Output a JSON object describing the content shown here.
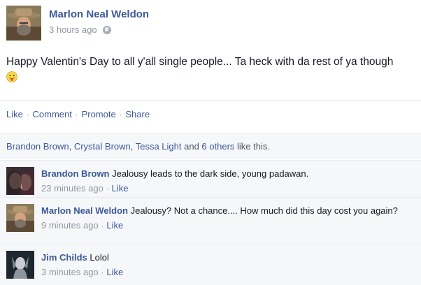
{
  "post": {
    "author": "Marlon Neal Weldon",
    "timestamp": "3 hours ago",
    "privacy_icon": "globe-icon",
    "text": "Happy Valentin's Day to all y'all single people... Ta heck with da rest of ya though",
    "emoji": "tongue-out-face"
  },
  "actions": {
    "like": "Like",
    "comment": "Comment",
    "promote": "Promote",
    "share": "Share",
    "separator": "·"
  },
  "likes_summary": {
    "names": "Brandon Brown, Crystal Brown, Tessa Light",
    "connector": " and ",
    "others": "6 others",
    "suffix": " like this."
  },
  "comments": [
    {
      "name": "Brandon Brown",
      "text": " Jealousy leads to the dark side, young padawan.",
      "time": "23 minutes ago",
      "like": "Like"
    },
    {
      "name": "Marlon Neal Weldon",
      "text": " Jealousy? Not a chance.... How much did this day cost you again?",
      "time": "9 minutes ago",
      "like": "Like"
    },
    {
      "name": "Jim Childs",
      "text": " Lolol",
      "time": "3 minutes ago",
      "like": "Like"
    }
  ],
  "colors": {
    "link": "#3b5998",
    "meta": "#9197a3",
    "panel": "#f6f7f9"
  }
}
